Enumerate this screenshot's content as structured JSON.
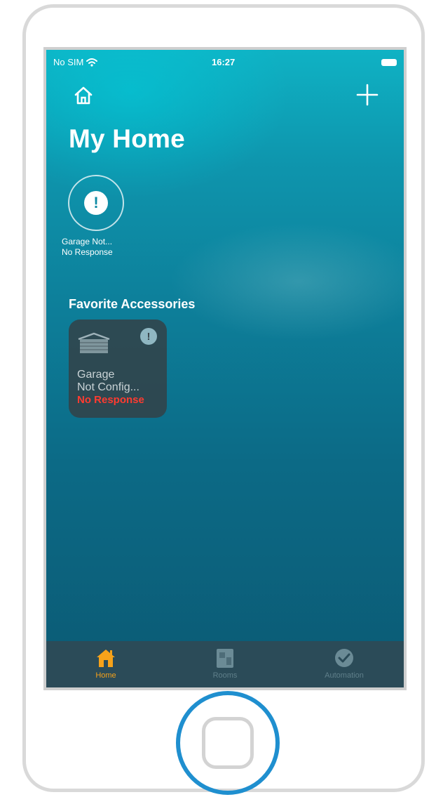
{
  "status_bar": {
    "carrier": "No SIM",
    "time": "16:27",
    "wifi_icon": "wifi-icon",
    "battery_icon": "battery-icon"
  },
  "header": {
    "home_icon": "house-outline-icon",
    "add_icon": "plus-icon",
    "title": "My Home"
  },
  "status_summary": {
    "icon": "exclamation-icon",
    "alert_glyph": "!",
    "line1": "Garage Not...",
    "line2": "No Response"
  },
  "favorites": {
    "heading": "Favorite Accessories",
    "items": [
      {
        "icon": "garage-door-icon",
        "alert_glyph": "!",
        "name_line1": "Garage",
        "name_line2": "Not Config...",
        "status": "No Response"
      }
    ]
  },
  "tab_bar": {
    "tabs": [
      {
        "label": "Home",
        "icon": "house-icon",
        "active": true
      },
      {
        "label": "Rooms",
        "icon": "rooms-icon",
        "active": false
      },
      {
        "label": "Automation",
        "icon": "clock-check-icon",
        "active": false
      }
    ]
  },
  "colors": {
    "accent": "#f6a21a",
    "error": "#ff3b30",
    "ring": "#1f8fcf",
    "tab_bar_bg": "#2b4b58"
  }
}
